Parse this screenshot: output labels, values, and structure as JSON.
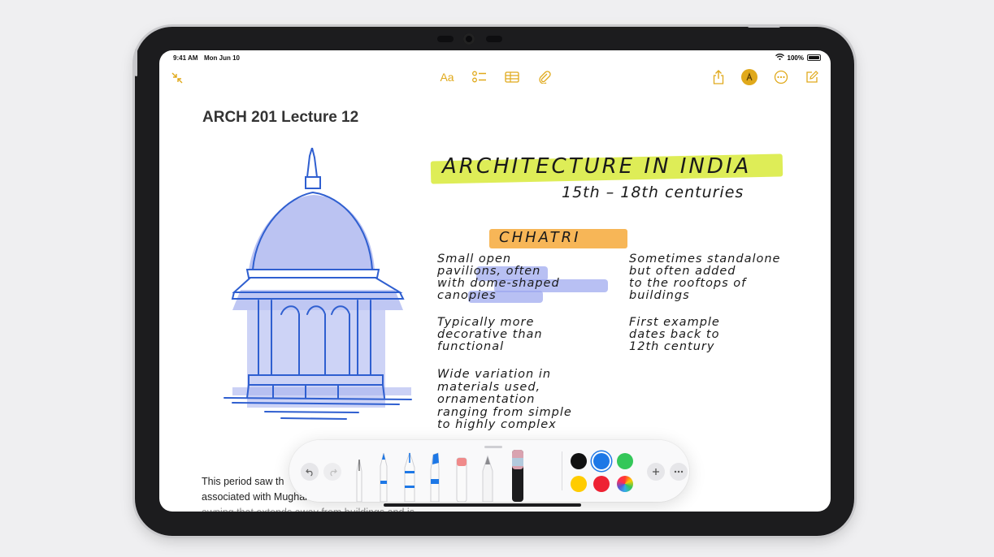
{
  "status_bar": {
    "time": "9:41 AM",
    "date": "Mon Jun 10",
    "battery": "100%"
  },
  "toolbar": {
    "collapse_icon": "collapse-arrows-icon",
    "format_label": "Aa",
    "checklist_icon": "checklist-icon",
    "table_icon": "table-icon",
    "attachment_icon": "paperclip-icon",
    "share_icon": "share-icon",
    "markup_icon": "markup-pen-icon",
    "more_icon": "ellipsis-circle-icon",
    "compose_icon": "compose-icon",
    "accent_color": "#e0a91b"
  },
  "note": {
    "title": "ARCH 201 Lecture 12",
    "handwriting": {
      "heading": "ARCHITECTURE IN INDIA",
      "subheading": "15th – 18th centuries",
      "section": "CHHATRI",
      "bullets_left": [
        "Small open\npavilions, often\nwith dome-shaped\ncanopies",
        "Typically more\ndecorative than\nfunctional",
        "Wide variation in\nmaterials used,\nornamentation\nranging from simple\nto highly complex"
      ],
      "bullets_right": [
        "Sometimes standalone\nbut often added\nto the rooftops of\nbuildings",
        "First example\ndates back to\n12th century"
      ]
    },
    "typed_text": [
      "This period saw th",
      "associated with Mughal",
      "awning that extends away from buildings and is"
    ],
    "sketch_color": "#2f5fd0"
  },
  "palette": {
    "undo_icon": "undo-icon",
    "redo_icon": "redo-icon",
    "tools": [
      "pen",
      "monoline",
      "fountain-pen",
      "marker",
      "eraser",
      "pencil",
      "crayon"
    ],
    "colors": [
      "#111111",
      "#1e78e6",
      "#34c759",
      "#ffcc00",
      "#ee2233",
      "color-wheel"
    ],
    "selected_color": "#1e78e6",
    "add_icon": "plus-icon",
    "more_icon": "ellipsis-icon"
  }
}
